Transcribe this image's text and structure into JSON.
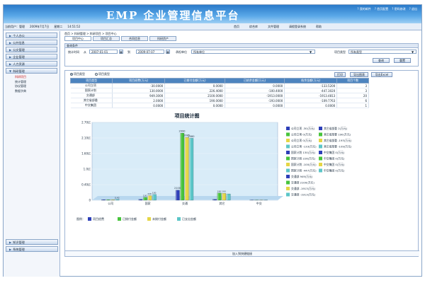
{
  "header": {
    "title": "EMP 企业管理信息平台",
    "links": [
      "? 我的邮件",
      "? 首页配置",
      "? 密码修改",
      "? 退出"
    ]
  },
  "userbar": {
    "user": "当前用户：管理",
    "date": "2009年7月7日",
    "weekday": "星期二",
    "time": "14:51:52",
    "nav": [
      "首页",
      "综合库",
      "文件管理",
      "请假登录系统",
      "帮助"
    ]
  },
  "sidebar": {
    "menus": [
      "个人办公",
      "公共信息",
      "公文管理",
      "企业管理",
      "人力资源",
      "科研管理"
    ],
    "submenus": [
      "科研项目",
      "统计管理",
      "协议管理",
      "数据字典"
    ],
    "bottom_menus": [
      "知识管理",
      "系统管理"
    ]
  },
  "breadcrumb": "首页 > 科研管理 > 科研项目 > 项目中心",
  "tabs": [
    "项目中心",
    "项目汇总",
    "合同信息",
    "科研资产"
  ],
  "query": {
    "title": "查询条件",
    "date_label": "统计时间",
    "from_label": "从",
    "from": "2007-01-01",
    "to_label": "到",
    "to": "2009-07-07",
    "unit_label": "承担单位",
    "unit": "所有单位",
    "type_label": "项目类型",
    "type": "所有类型",
    "query_btn": "查询",
    "reset_btn": "重置",
    "calendar_icon": "calendar-icon"
  },
  "toolbar": {
    "radio1": "项目类型",
    "radio2": "项目类型",
    "print": "打印",
    "export_chart": "导出图表",
    "export_excel": "导出Excel"
  },
  "table": {
    "headers": [
      "项目类型",
      "项目经费(万元)",
      "已拨付金额(万元)",
      "已结余金额(万元)",
      "结余金额(万元)",
      "项目个数"
    ],
    "rows": [
      [
        "公司立项",
        "-30.0000",
        "0.0000",
        "0.0000",
        "-133.5200",
        "3"
      ],
      [
        "国家计划",
        "130.0000",
        "226.4000",
        "-100.4000",
        "-447.3020",
        "3"
      ],
      [
        "交通部",
        "949.3000",
        "2100.0000",
        "-1913.0000",
        "-1913.4813",
        "20"
      ],
      [
        "其它省部委",
        "2.0000",
        "190.0000",
        "-193.0000",
        "-109.7763",
        "6"
      ],
      [
        "中交集团",
        "0.0000",
        "0.0000",
        "0.0000",
        "0.0000",
        "1"
      ]
    ]
  },
  "chart_data": {
    "type": "bar",
    "title": "项目统计图",
    "categories": [
      "公司",
      "国家",
      "交通",
      "其它",
      "中交"
    ],
    "y_ticks": [
      "2.70亿",
      "2.10亿",
      "1.60亿",
      "1.0亿",
      "0.40亿",
      "0"
    ],
    "ylim": [
      0,
      2.7
    ],
    "ylabel": "",
    "series": [
      {
        "name": "项目经费",
        "color": "#2d3fb8",
        "values": [
          0.02,
          0.03,
          0.35,
          0.03,
          0.01
        ]
      },
      {
        "name": "已拨付金额",
        "color": "#48c43c",
        "values": [
          0.02,
          0.1,
          2.33,
          0.25,
          0.01
        ]
      },
      {
        "name": "未拨付金额",
        "color": "#e5d645",
        "values": [
          0.02,
          0.16,
          2.18,
          0.24,
          0.01
        ]
      },
      {
        "name": "已支出金额",
        "color": "#5cc6c8",
        "values": [
          0.03,
          0.2,
          2.15,
          0.22,
          0.01
        ]
      }
    ],
    "bar_labels": [
      "2100",
      "2090",
      "2085",
      "2080"
    ],
    "small_labels": [
      "130",
      "226",
      "100",
      "190",
      "193",
      "0.43"
    ]
  },
  "legend": [
    {
      "label": "公司立项 -30(万元)",
      "color": "#2d3fb8"
    },
    {
      "label": "其它省部委 2(万元)",
      "color": "#2d3fb8"
    },
    {
      "label": "公司立项 0(万元)",
      "color": "#48c43c"
    },
    {
      "label": "其它省部委 190(万元)",
      "color": "#48c43c"
    },
    {
      "label": "公司立项 0(万元)",
      "color": "#e5d645"
    },
    {
      "label": "其它省部委 -193(万元)",
      "color": "#e5d645"
    },
    {
      "label": "公司立项 -133(万元)",
      "color": "#5cc6c8"
    },
    {
      "label": "其它省部委 -109(万元)",
      "color": "#5cc6c8"
    },
    {
      "label": "国家计划 130(万元)",
      "color": "#2d3fb8"
    },
    {
      "label": "中交集团 0(万元)",
      "color": "#2d3fb8"
    },
    {
      "label": "国家计划 226(万元)",
      "color": "#48c43c"
    },
    {
      "label": "中交集团 0(万元)",
      "color": "#48c43c"
    },
    {
      "label": "国家计划 -100(万元)",
      "color": "#e5d645"
    },
    {
      "label": "中交集团 0(万元)",
      "color": "#e5d645"
    },
    {
      "label": "国家计划 -447(万元)",
      "color": "#5cc6c8"
    },
    {
      "label": "中交集团 0(万元)",
      "color": "#5cc6c8"
    },
    {
      "label": "交通部 949(万元)",
      "color": "#2d3fb8"
    },
    {
      "label": "交通部 2100(万元)",
      "color": "#48c43c"
    },
    {
      "label": "交通部 -1913(万元)",
      "color": "#e5d645"
    },
    {
      "label": "交通部 -1913(万元)",
      "color": "#5cc6c8"
    }
  ],
  "legend_bottom_label": "图例：",
  "footer": "加入到快捷链接"
}
